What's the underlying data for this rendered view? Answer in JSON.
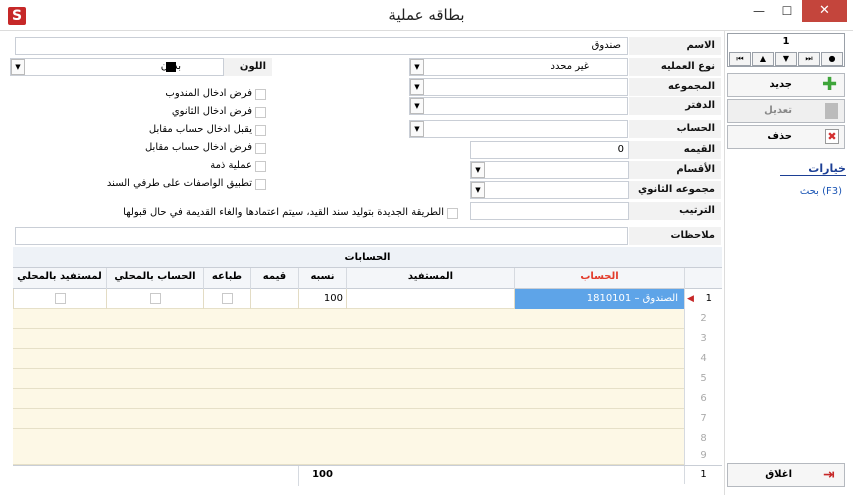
{
  "window": {
    "title": "بطاقه عملية",
    "app_icon_glyph": "S",
    "minimize": "—",
    "maximize": "☐",
    "close": "✕"
  },
  "form": {
    "name_label": "الاسم",
    "name_value": "صندوق",
    "op_type_label": "نوع العمليه",
    "op_type_value": "غير محدد",
    "group_label": "المجموعه",
    "book_label": "الدفتر",
    "account_label": "الحساب",
    "value_label": "القيمه",
    "value_value": "0",
    "sections_label": "الأقسام",
    "secondary_group_label": "مجموعه الثانوي",
    "order_label": "الترتيب",
    "notes_label": "ملاحظات",
    "color_label": "اللون",
    "color_value": "بدون",
    "color_swatch": "#000000"
  },
  "checks": [
    {
      "label": "فرض ادخال المندوب"
    },
    {
      "label": "فرض ادخال الثانوي"
    },
    {
      "label": "يقبل ادخال حساب مقابل"
    },
    {
      "label": "فرض ادخال حساب مقابل"
    },
    {
      "label": "عملية ذمة"
    },
    {
      "label": "تطبيق الواصفات على طرفي السند"
    }
  ],
  "new_method_label": "الطريقة الجديدة بتوليد سند القيد، سيتم اعتمادها والغاء القديمة في حال قبولها",
  "grid": {
    "caption": "الحسابات",
    "columns": [
      "الحساب",
      "المستفيد",
      "نسبه",
      "قيمه",
      "طباعه",
      "الحساب بالمحلي",
      "لمستفيد بالمحلي"
    ],
    "row1_account": "1810101 – الصندوق",
    "row1_percent": "100",
    "row_numbers": [
      "1",
      "2",
      "3",
      "4",
      "5",
      "6",
      "7",
      "8",
      "9"
    ],
    "footer_count": "1",
    "footer_total": "100"
  },
  "nav": {
    "record_number": "1",
    "first": "⏮",
    "prev": "▲",
    "next": "▼",
    "last": "⏭",
    "dot": "●"
  },
  "actions": {
    "new": "جديد",
    "edit": "تعديل",
    "delete": "حذف",
    "close": "اغلاق"
  },
  "options_label": "خيارات",
  "search_label": "بحث  (F3)"
}
